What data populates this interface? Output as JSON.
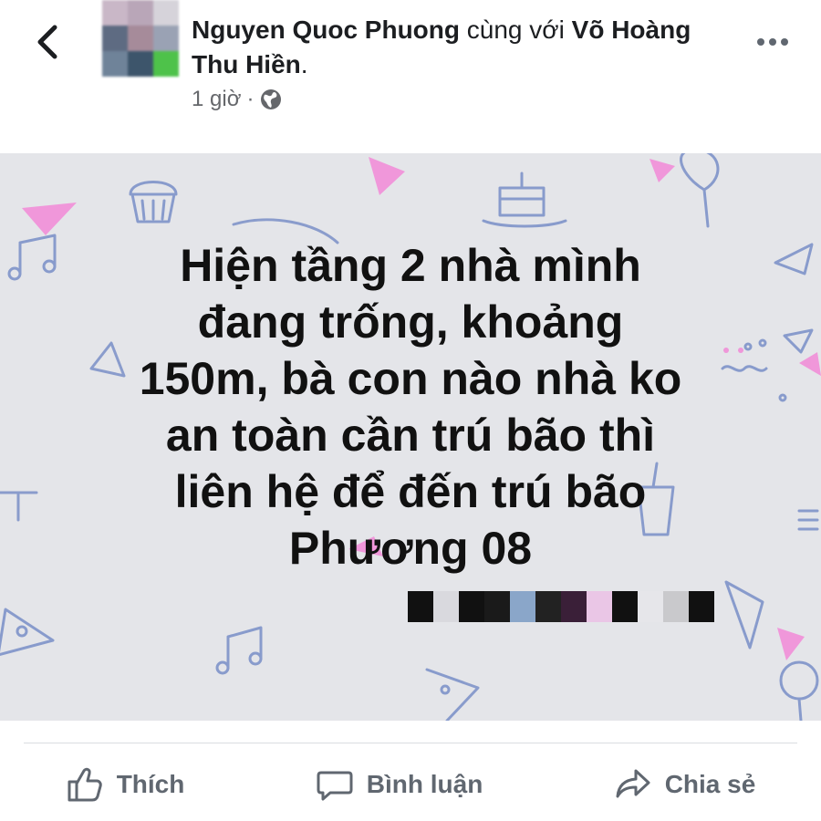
{
  "header": {
    "author": "Nguyen Quoc Phuong",
    "with_text": " cùng với ",
    "tagged": "Võ Hoàng Thu Hiền",
    "period": ".",
    "time": "1 giờ",
    "separator": "·",
    "privacy_icon": "globe-icon"
  },
  "post": {
    "text": "Hiện tầng 2 nhà mình\nđang trống, khoảng\n150m, bà con nào nhà ko\nan toàn cần trú bão thì\nliên hệ để đến trú bão\nPhương 08",
    "background_color": "#e4e5e9"
  },
  "actions": {
    "like_label": "Thích",
    "comment_label": "Bình luận",
    "share_label": "Chia sẻ"
  },
  "colors": {
    "text_primary": "#1c1e21",
    "text_secondary": "#65676b",
    "action_gray": "#606770",
    "doodle_blue": "#7f93c9",
    "doodle_pink": "#f28ad7"
  }
}
